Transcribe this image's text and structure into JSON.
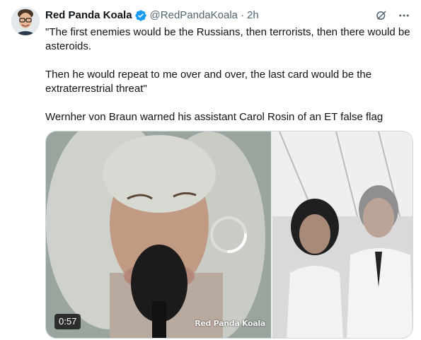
{
  "tweet": {
    "author_name": "Red Panda Koala",
    "handle": "@RedPandaKoala",
    "separator": "·",
    "time": "2h",
    "paragraphs": [
      "\"The first enemies would be the Russians, then terrorists, then there would be asteroids.",
      "Then he would repeat to me over and over, the last card would be the extraterrestrial threat\"",
      "Wernher von Braun warned his assistant Carol Rosin of an ET false flag"
    ]
  },
  "media": {
    "video_duration": "0:57",
    "video_watermark": "Red Panda Koala",
    "video_state": "loading"
  },
  "icons": {
    "verified": "verified-badge-icon",
    "grok": "grok-icon",
    "more": "more-options-icon"
  },
  "colors": {
    "text_primary": "#0f1419",
    "text_secondary": "#536471",
    "verified_blue": "#1d9bf0",
    "border": "#cfd9de"
  }
}
